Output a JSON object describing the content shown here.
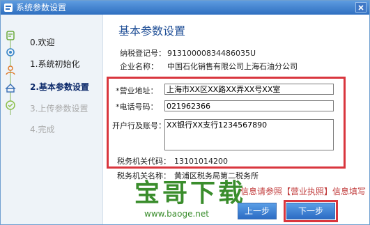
{
  "window": {
    "title": "系统参数设置",
    "icon": "app-icon",
    "close_icon": "close-icon"
  },
  "sidebar": {
    "steps": [
      {
        "label": "0.欢迎",
        "icon": "welcome-step-icon",
        "state": "done"
      },
      {
        "label": "1.系统初始化",
        "icon": "gear-step-icon",
        "state": "done"
      },
      {
        "label": "2.基本参数设置",
        "icon": "user-step-icon",
        "state": "active"
      },
      {
        "label": "3.上传参数设置",
        "icon": "upload-step-icon",
        "state": "pending"
      },
      {
        "label": "4.完成",
        "icon": "check-step-icon",
        "state": "pending"
      }
    ]
  },
  "main": {
    "heading": "基本参数设置",
    "tax_id_label": "纳税登记号：",
    "tax_id_value": "91310000834486035U",
    "company_label": "企业名称：",
    "company_value": "中国石化销售有限公司上海石油分公司",
    "address_label": "*营业地址：",
    "address_value": "上海市XX区XX路XX弄XX号XX室",
    "phone_label": "*电话号码：",
    "phone_value": "021962366",
    "bank_label": "开户行及账号：",
    "bank_value": "XX银行XX支行1234567890",
    "tax_office_code_label": "税务机关代码：",
    "tax_office_code_value": "13101014200",
    "tax_office_name_label": "税务机关名称：",
    "tax_office_name_value": "黄浦区税务局第二税务所",
    "hint": "信息请参照【营业执照】信息填写"
  },
  "buttons": {
    "prev": "上一步",
    "next": "下一步"
  },
  "watermark": {
    "text": "宝哥下载",
    "url": "www.baoge.net"
  },
  "colors": {
    "accent": "#1f4e96",
    "highlight": "#d9363e",
    "title_bar": "#3a7bd0",
    "watermark": "#3a8d2c"
  }
}
